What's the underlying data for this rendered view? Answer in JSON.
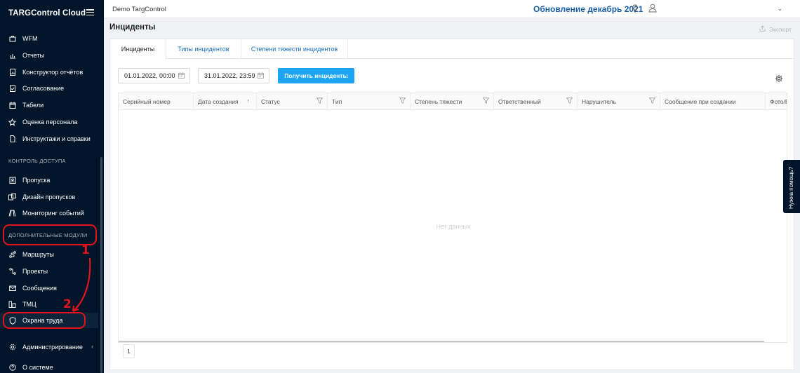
{
  "app": {
    "brand": "TARGControl Cloud"
  },
  "sidebar": {
    "items_top": [
      {
        "label": "WFM",
        "icon": "briefcase-icon"
      },
      {
        "label": "Отчеты",
        "icon": "bar-chart-icon"
      },
      {
        "label": "Конструктор отчётов",
        "icon": "report-builder-icon"
      },
      {
        "label": "Согласование",
        "icon": "approval-icon"
      },
      {
        "label": "Табели",
        "icon": "calendar-icon"
      },
      {
        "label": "Оценка персонала",
        "icon": "star-icon"
      },
      {
        "label": "Инструктажи и справки",
        "icon": "document-icon"
      }
    ],
    "section_access": "КОНТРОЛЬ ДОСТУПА",
    "items_access": [
      {
        "label": "Пропуска",
        "icon": "badge-icon"
      },
      {
        "label": "Дизайн пропусков",
        "icon": "pass-design-icon"
      },
      {
        "label": "Мониторинг событий",
        "icon": "monitoring-icon"
      }
    ],
    "section_modules": "ДОПОЛНИТЕЛЬНЫЕ МОДУЛИ",
    "items_modules": [
      {
        "label": "Маршруты",
        "icon": "route-icon"
      },
      {
        "label": "Проекты",
        "icon": "projects-icon"
      },
      {
        "label": "Сообщения",
        "icon": "mail-icon"
      },
      {
        "label": "ТМЦ",
        "icon": "inventory-icon"
      },
      {
        "label": "Охрана труда",
        "icon": "shield-icon",
        "active": true
      }
    ],
    "items_bottom": [
      {
        "label": "Администрирование",
        "icon": "settings-icon"
      },
      {
        "label": "О системе",
        "icon": "help-circle-icon"
      }
    ]
  },
  "annotations": {
    "step1": "1",
    "step2": "2",
    "color": "#e0141b"
  },
  "header": {
    "company": "Demo TargControl",
    "update_title": "Обновление декабрь 2021"
  },
  "page": {
    "title": "Инциденты",
    "export_label": "Экспорт"
  },
  "tabs": [
    {
      "label": "Инциденты",
      "active": true
    },
    {
      "label": "Типы инцидентов",
      "active": false
    },
    {
      "label": "Степени тяжести инцидентов",
      "active": false
    }
  ],
  "filters": {
    "date_from": "01.01.2022, 00:00",
    "date_to": "31.01.2022, 23:59",
    "get_button": "Получить инциденты"
  },
  "table": {
    "columns": [
      "Серийный номер",
      "Дата создания",
      "Статус",
      "Тип",
      "Степень тяжести",
      "Ответственный",
      "Нарушитель",
      "Сообщение при создании",
      "Фото/В"
    ],
    "empty_text": "Нет данных",
    "current_page": "1"
  },
  "help_tab": "Нужна помощь?",
  "colors": {
    "sidebar": "#001529",
    "accent": "#1ba5f4",
    "link": "#1a6fc2"
  }
}
